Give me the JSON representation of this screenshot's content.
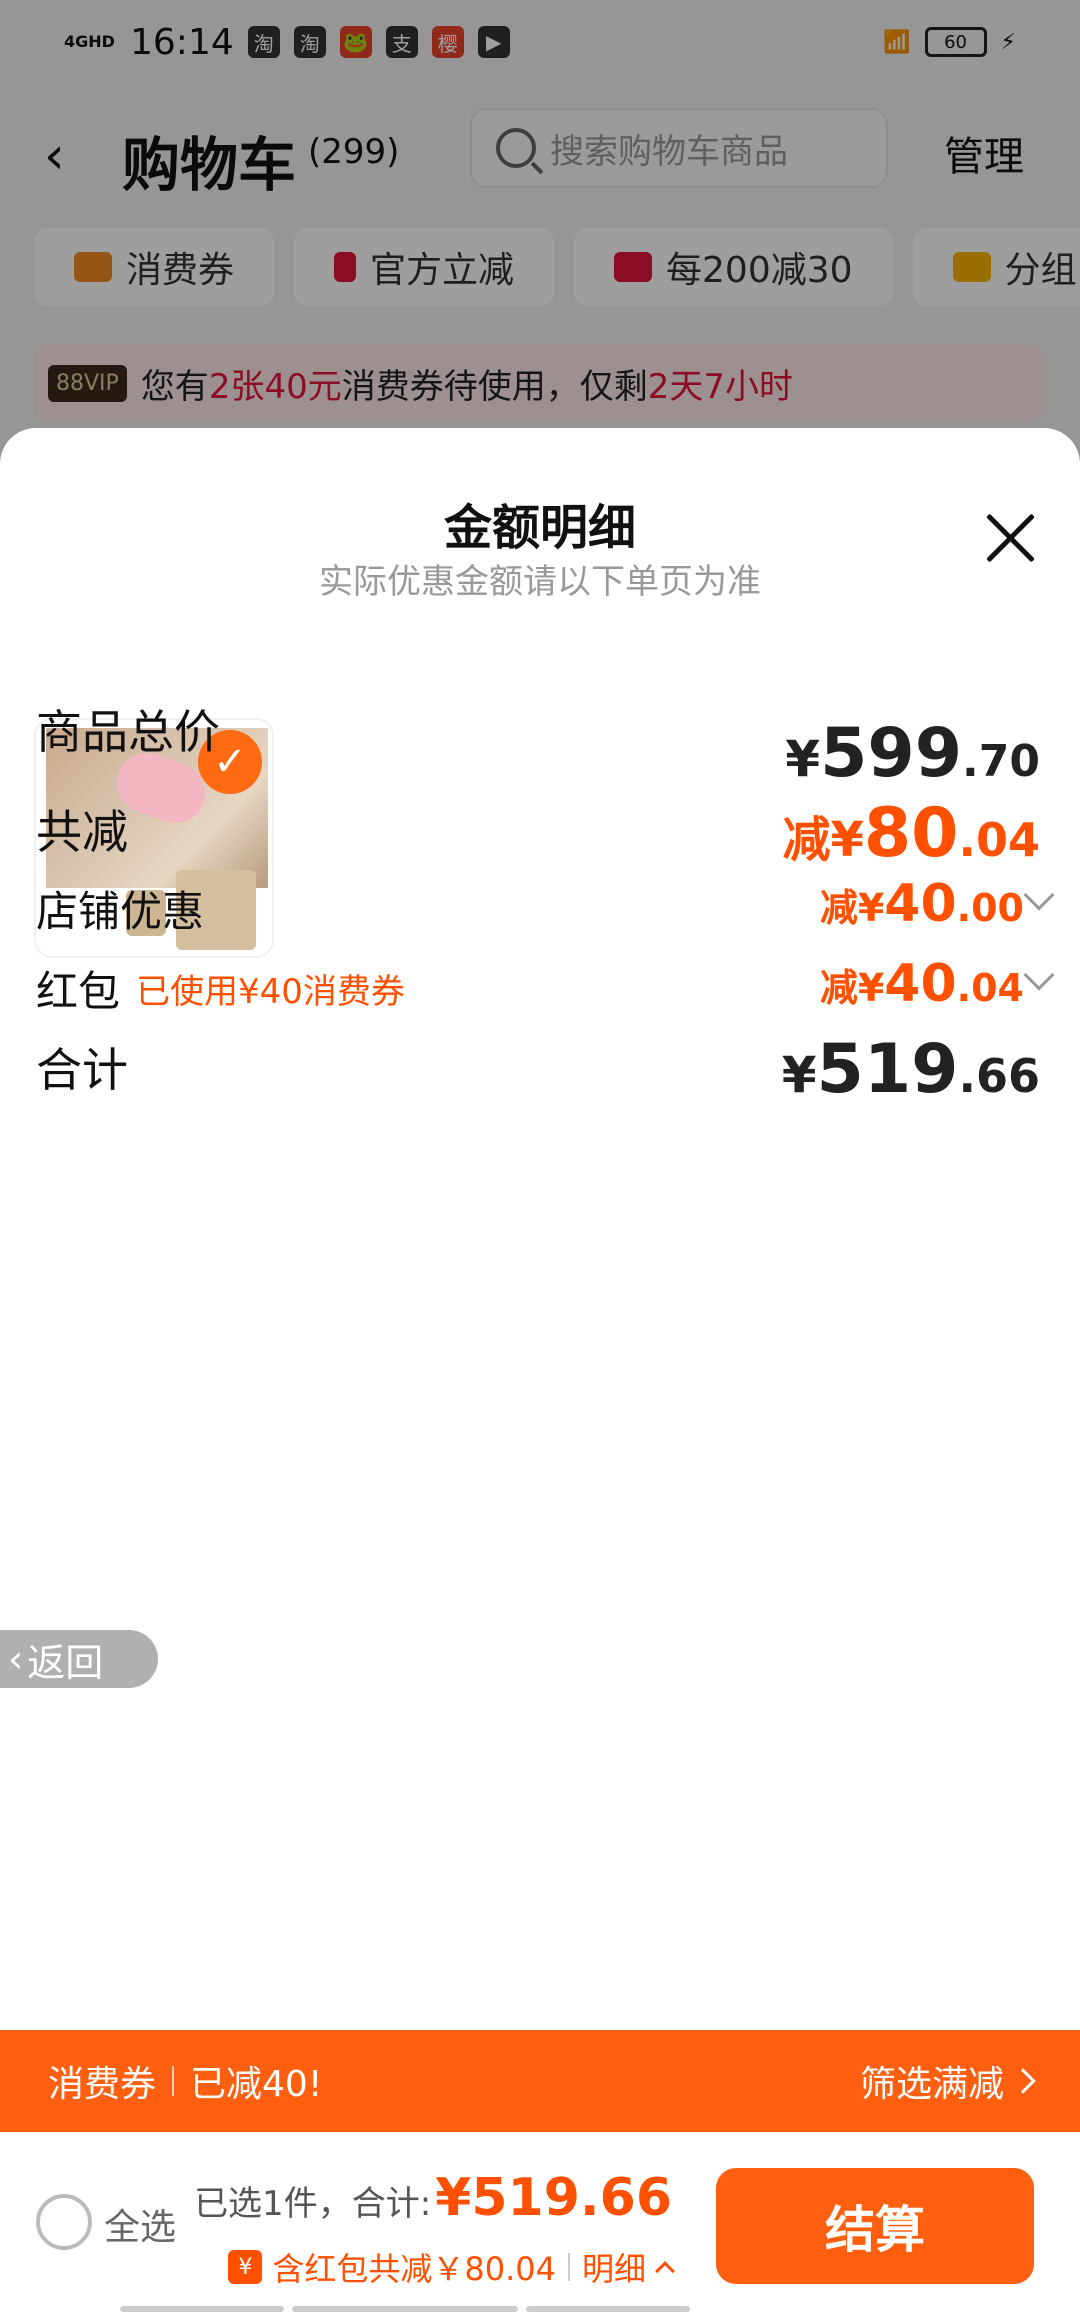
{
  "status_bar": {
    "network": "4GHD",
    "time": "16:14",
    "app_icons": [
      "淘",
      "淘",
      "🐸",
      "支",
      "樱",
      "▶"
    ],
    "battery": "60"
  },
  "nav": {
    "title": "购物车",
    "count": "(299)",
    "search_placeholder": "搜索购物车商品",
    "manage": "管理"
  },
  "chips": [
    {
      "label": "消费券",
      "color": "#f08a24"
    },
    {
      "label": "官方立减",
      "color": "#e4143c"
    },
    {
      "label": "每200减30",
      "color": "#e4143c"
    },
    {
      "label": "分组",
      "color": "#f5b400"
    }
  ],
  "vip_bar": {
    "badge": "88VIP",
    "text_1": "您有",
    "highlight_1": "2张40元",
    "text_2": "消费券待使用，仅剩",
    "highlight_2": "2天7小时"
  },
  "sheet": {
    "title": "金额明细",
    "subtitle": "实际优惠金额请以下单页为准",
    "rows": {
      "total": {
        "label": "商品总价",
        "currency": "¥",
        "integer": "599",
        "decimal": ".70"
      },
      "discount": {
        "label": "共减",
        "prefix": "减¥",
        "integer": "80",
        "decimal": ".04"
      },
      "store": {
        "label": "店铺优惠",
        "prefix": "减¥",
        "integer": "40",
        "decimal": ".00"
      },
      "redpack": {
        "label": "红包",
        "tag": "已使用¥40消费券",
        "prefix": "减¥",
        "integer": "40",
        "decimal": ".04"
      },
      "sum": {
        "label": "合计",
        "currency": "¥",
        "integer": "519",
        "decimal": ".66"
      }
    },
    "back_tab": "返回"
  },
  "promo_bar": {
    "left_1": "消费券",
    "left_2": "已减40!",
    "right": "筛选满减"
  },
  "bottom": {
    "select_all": "全选",
    "selected": "已选1件，合计:",
    "price": "¥519.66",
    "discount_note": "含红包共减￥80.04",
    "detail": "明细",
    "checkout": "结算"
  },
  "colors": {
    "accent": "#ff5000",
    "vip_red": "#e4143c"
  }
}
